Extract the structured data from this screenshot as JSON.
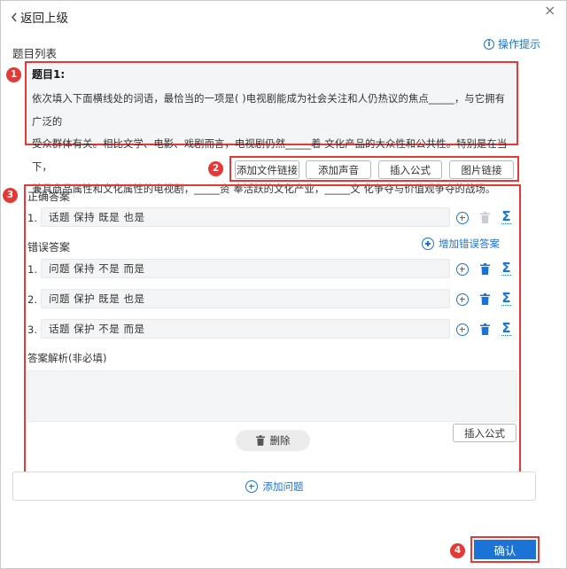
{
  "header": {
    "back_label": "返回上级",
    "back_icon": "chevron-left-icon",
    "close_icon": "close-icon",
    "close_glyph": "×"
  },
  "section_title": "题目列表",
  "help": {
    "label": "操作提示",
    "glyph": "i"
  },
  "badges": [
    "1",
    "2",
    "3",
    "4"
  ],
  "question": {
    "title": "题目1:",
    "lines": [
      "依次填入下面横线处的词语，最恰当的一项是( )电视剧能成为社会关注和人仍热议的焦点_____，与它拥有广泛的",
      "受众群体有关。相比文学、电影、戏剧而言，电视剧仍然_____着 文化产品的大众性和公共性。特别是在当下，",
      "兼具商品属性和文化属性的电视剧，_____资 奉活跃的文化产业，_____文 化争夺与价值观争夺的战场。"
    ]
  },
  "toolbar": {
    "add_file_link": "添加文件链接",
    "add_sound": "添加声音",
    "insert_formula": "插入公式",
    "image_link": "图片链接"
  },
  "correct": {
    "title": "正确答案",
    "items": [
      {
        "num": "1.",
        "value": "话题  保持  既是  也是"
      }
    ]
  },
  "wrong": {
    "title": "错误答案",
    "add_label": "增加错误答案",
    "items": [
      {
        "num": "1.",
        "value": "问题  保持  不是  而是"
      },
      {
        "num": "2.",
        "value": "问题  保护  既是  也是"
      },
      {
        "num": "3.",
        "value": "话题  保护  不是  而是"
      }
    ]
  },
  "analysis": {
    "label": "答案解析(非必填)",
    "value": "",
    "insert_formula": "插入公式",
    "delete_label": "删除"
  },
  "add_question_label": "添加问题",
  "confirm_label": "确认",
  "icons": {
    "sigma": "Σ",
    "plus": "plus-circle-icon",
    "trash": "trash-icon",
    "formula": "sigma-icon"
  },
  "colors": {
    "accent": "#1b73d8",
    "annotation": "#e53935",
    "disabled_icon": "#c7ccd3"
  }
}
